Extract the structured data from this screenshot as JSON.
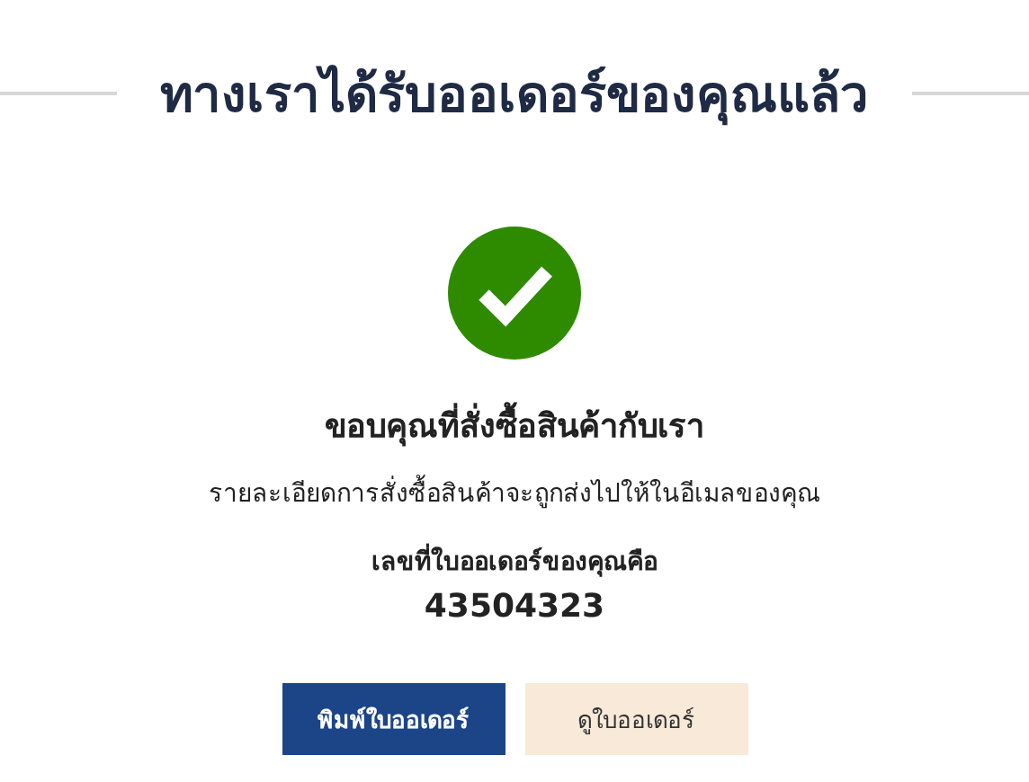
{
  "title": "ทางเราได้รับออเดอร์ของคุณแล้ว",
  "success": {
    "heading": "ขอบคุณที่สั่งซื้อสินค้ากับเรา",
    "message": "รายละเอียดการสั่งซื้อสินค้าจะถูกส่งไปให้ในอีเมลของคุณ",
    "order_label": "เลขที่ใบออเดอร์ของคุณคือ",
    "order_number": "43504323"
  },
  "buttons": [
    {
      "label": "พิมพ์ใบออเดอร์",
      "kind": "primary"
    },
    {
      "label": "ดูใบออเดอร์",
      "kind": "secondary"
    }
  ]
}
